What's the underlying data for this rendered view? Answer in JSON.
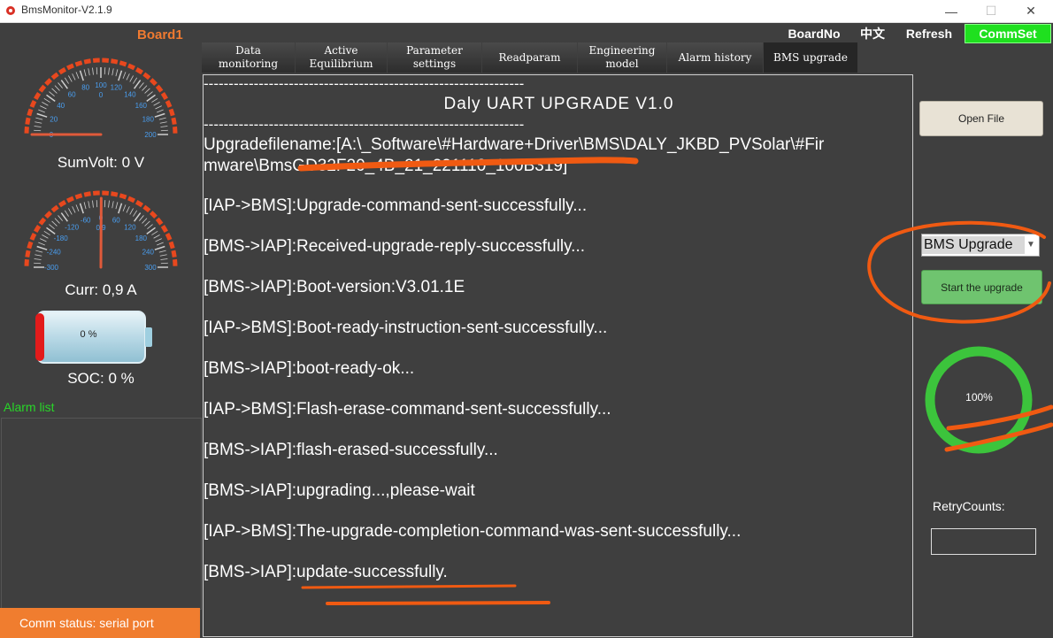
{
  "window": {
    "title": "BmsMonitor-V2.1.9",
    "controls": {
      "minimize": "—",
      "maximize": "☐",
      "close": "✕"
    }
  },
  "left_panel": {
    "board_label": "Board1",
    "volt_gauge": {
      "ticks": [
        "0",
        "20",
        "40",
        "60",
        "80",
        "100",
        "120",
        "140",
        "160",
        "180",
        "200"
      ],
      "center_value": "0",
      "label": "SumVolt: 0 V",
      "needle_value": 0
    },
    "curr_gauge": {
      "ticks": [
        "-300",
        "-240",
        "-180",
        "-120",
        "-60",
        "0",
        "60",
        "120",
        "180",
        "240",
        "300"
      ],
      "center_value": "0,9",
      "label": "Curr: 0,9 A",
      "needle_value": 0.9
    },
    "battery": {
      "percent_text": "0 %",
      "label": "SOC: 0 %"
    },
    "alarm_list_label": "Alarm list",
    "comm_status": "Comm status: serial port"
  },
  "top_bar": {
    "board_no": "BoardNo",
    "language": "中文",
    "refresh": "Refresh",
    "comm_set": "CommSet"
  },
  "tabs": [
    {
      "label_line1": "Data",
      "label_line2": "monitoring"
    },
    {
      "label_line1": "Active",
      "label_line2": "Equilibrium"
    },
    {
      "label_line1": "Parameter",
      "label_line2": "settings"
    },
    {
      "label_line1": "Readparam",
      "label_line2": ""
    },
    {
      "label_line1": "Engineering",
      "label_line2": "model"
    },
    {
      "label_line1": "Alarm history",
      "label_line2": ""
    },
    {
      "label_line1": "BMS upgrade",
      "label_line2": "",
      "active": true
    }
  ],
  "log": {
    "dash_line": "----------------------------------------------------------------",
    "heading": "Daly UART UPGRADE V1.0",
    "filename_line1": "Upgradefilename:[A:\\_Software\\#Hardware+Driver\\BMS\\DALY_JKBD_PVSolar\\#Fir",
    "filename_line2": "mware\\BmsGD32F20_4B_21_221110_100B319]",
    "lines": [
      "[IAP->BMS]:Upgrade-command-sent-successfully...",
      "[BMS->IAP]:Received-upgrade-reply-successfully...",
      "[BMS->IAP]:Boot-version:V3.01.1E",
      "[IAP->BMS]:Boot-ready-instruction-sent-successfully...",
      "[BMS->IAP]:boot-ready-ok...",
      "[IAP->BMS]:Flash-erase-command-sent-successfully...",
      "[BMS->IAP]:flash-erased-successfully...",
      "[BMS->IAP]:upgrading...,please-wait",
      "[IAP->BMS]:The-upgrade-completion-command-was-sent-successfully...",
      "[BMS->IAP]:update-successfully."
    ]
  },
  "right_panel": {
    "open_file": "Open File",
    "upgrade_select": "BMS Upgrade",
    "start_upgrade": "Start the upgrade",
    "progress_text": "100%",
    "progress_value": 1.0,
    "retry_label": "RetryCounts:",
    "retry_value": ""
  },
  "colors": {
    "background": "#3f3f3f",
    "accent_orange": "#f07a30",
    "comm_set_green": "#1fe01f",
    "progress_green": "#3cc43c",
    "alarm_label_green": "#28d628"
  }
}
